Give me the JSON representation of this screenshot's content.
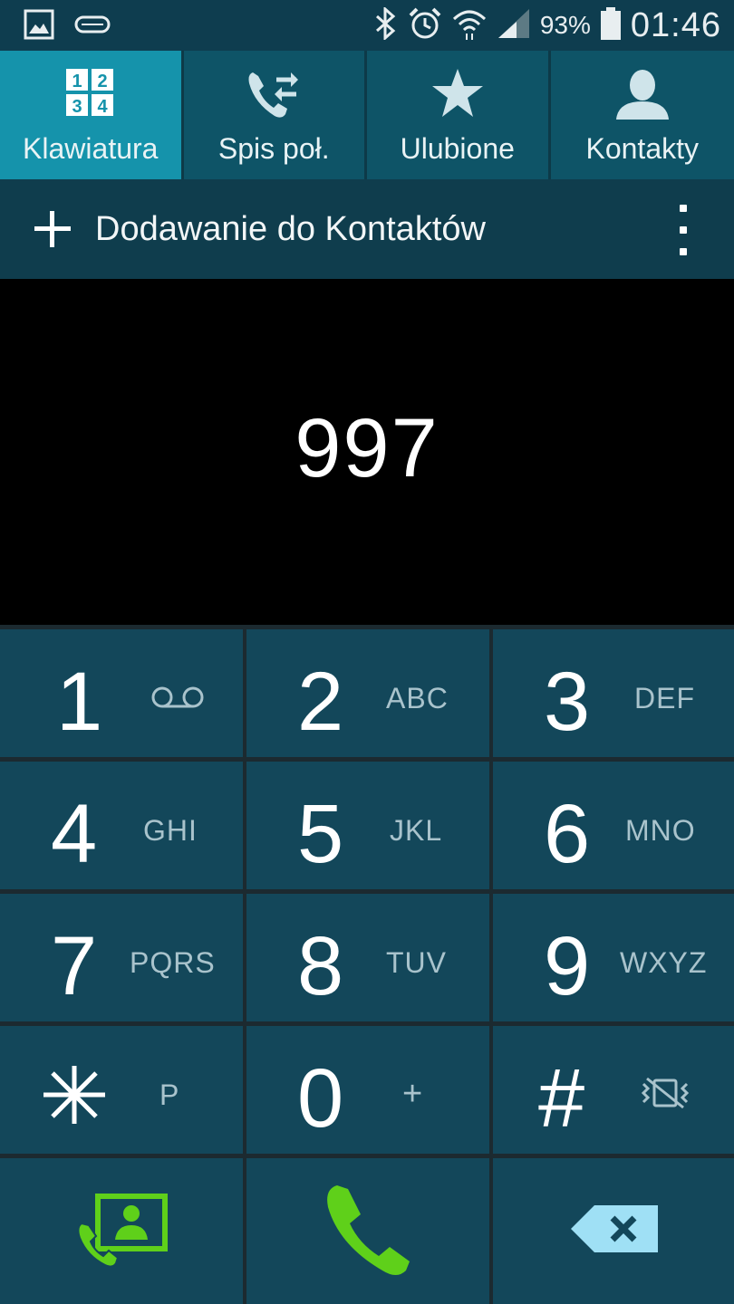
{
  "status_bar": {
    "battery_percent": "93%",
    "battery_level": 0.93,
    "time": "01:46",
    "icons": [
      "gallery-icon",
      "device-icon",
      "bluetooth-icon",
      "alarm-icon",
      "wifi-icon",
      "signal-icon",
      "battery-icon"
    ]
  },
  "tabs": [
    {
      "label": "Klawiatura",
      "icon": "keypad-icon",
      "active": true
    },
    {
      "label": "Spis poł.",
      "icon": "call-log-icon",
      "active": false
    },
    {
      "label": "Ulubione",
      "icon": "star-icon",
      "active": false
    },
    {
      "label": "Kontakty",
      "icon": "contact-icon",
      "active": false
    }
  ],
  "action_bar": {
    "add_label": "Dodawanie do Kontaktów",
    "add_icon": "plus-icon",
    "menu_icon": "overflow-menu-icon"
  },
  "dialer": {
    "number": "997"
  },
  "keypad": {
    "keys": [
      {
        "digit": "1",
        "letters": ""
      },
      {
        "digit": "2",
        "letters": "ABC"
      },
      {
        "digit": "3",
        "letters": "DEF"
      },
      {
        "digit": "4",
        "letters": "GHI"
      },
      {
        "digit": "5",
        "letters": "JKL"
      },
      {
        "digit": "6",
        "letters": "MNO"
      },
      {
        "digit": "7",
        "letters": "PQRS"
      },
      {
        "digit": "8",
        "letters": "TUV"
      },
      {
        "digit": "9",
        "letters": "WXYZ"
      },
      {
        "digit": "",
        "letters": "P"
      },
      {
        "digit": "0",
        "letters": "+"
      },
      {
        "digit": "#",
        "letters": ""
      }
    ],
    "bottom": {
      "left_icon": "contact-call-icon",
      "center_icon": "call-icon",
      "right_icon": "backspace-icon"
    }
  },
  "colors": {
    "status_bar_bg": "#0e3d4f",
    "tab_active": "#1593ab",
    "tab_inactive": "#0e5467",
    "key_bg": "#13475a",
    "call_green": "#5fd01a",
    "backspace_blue": "#9fe0f5"
  }
}
